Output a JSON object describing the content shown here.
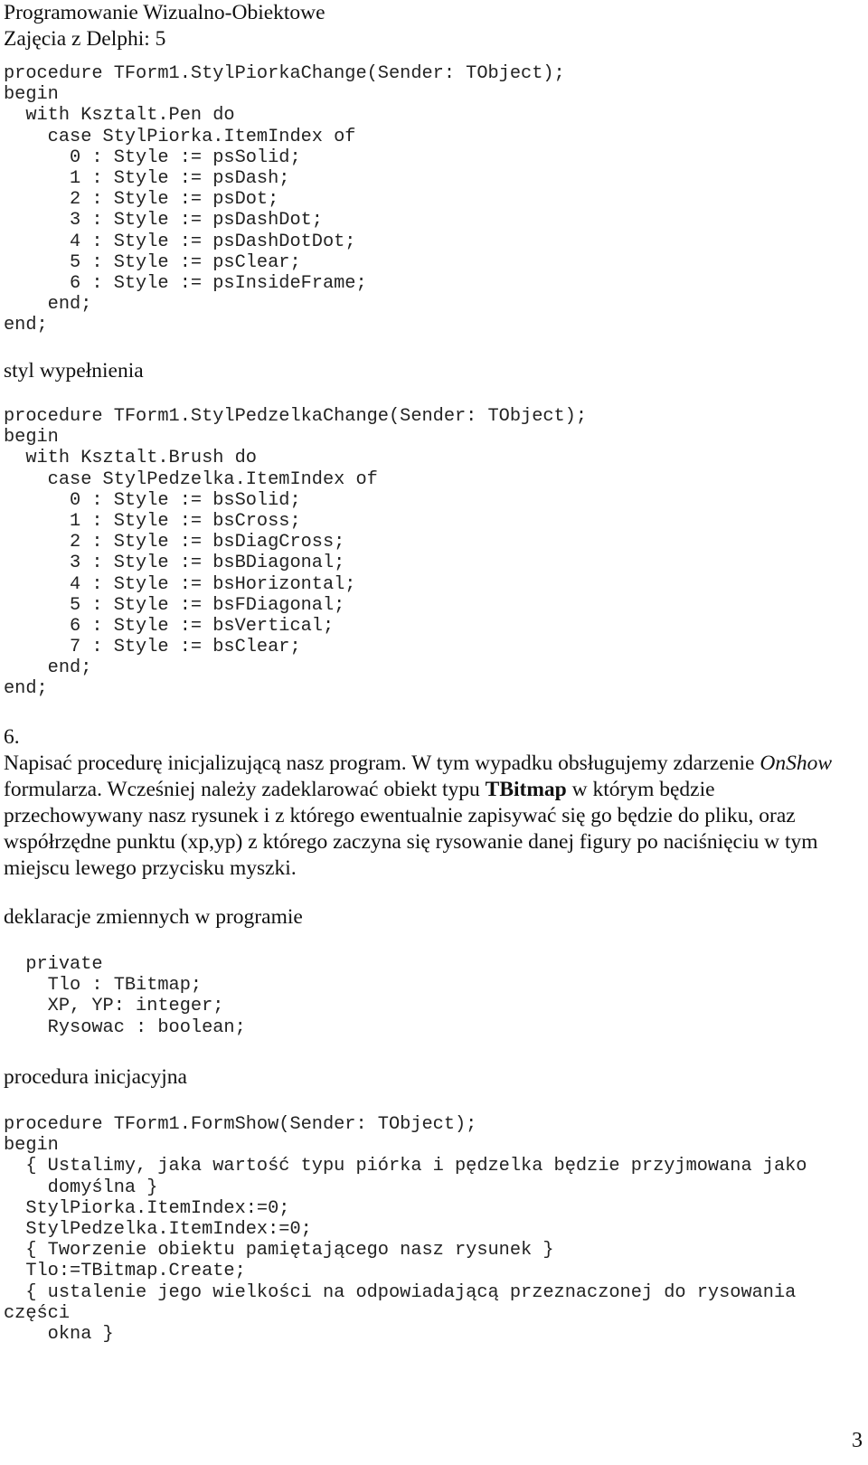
{
  "header": {
    "title": "Programowanie Wizualno-Obiektowe",
    "subtitle": "Zajęcia z Delphi: 5"
  },
  "code_pen": [
    "procedure TForm1.StylPiorkaChange(Sender: TObject);",
    "begin",
    "  with Ksztalt.Pen do",
    "    case StylPiorka.ItemIndex of",
    "      0 : Style := psSolid;",
    "      1 : Style := psDash;",
    "      2 : Style := psDot;",
    "      3 : Style := psDashDot;",
    "      4 : Style := psDashDotDot;",
    "      5 : Style := psClear;",
    "      6 : Style := psInsideFrame;",
    "    end;",
    "end;"
  ],
  "heading_fill": "styl wypełnienia",
  "code_brush": [
    "procedure TForm1.StylPedzelkaChange(Sender: TObject);",
    "begin",
    "  with Ksztalt.Brush do",
    "    case StylPedzelka.ItemIndex of",
    "      0 : Style := bsSolid;",
    "      1 : Style := bsCross;",
    "      2 : Style := bsDiagCross;",
    "      3 : Style := bsBDiagonal;",
    "      4 : Style := bsHorizontal;",
    "      5 : Style := bsFDiagonal;",
    "      6 : Style := bsVertical;",
    "      7 : Style := bsClear;",
    "    end;",
    "end;"
  ],
  "section6": {
    "number": "6.",
    "text_1": "Napisać procedurę inicjalizującą nasz program. W tym wypadku obsługujemy zdarzenie ",
    "event_name": "OnShow",
    "text_2": " formularza. Wcześniej należy zadeklarować obiekt typu ",
    "type_name": "TBitmap",
    "text_3": " w którym będzie przechowywany nasz rysunek i z którego ewentualnie zapisywać się go będzie do pliku, oraz współrzędne punktu (xp,yp) z którego zaczyna się rysowanie danej figury po naciśnięciu w tym miejscu lewego przycisku myszki."
  },
  "heading_decl": "deklaracje zmiennych w programie",
  "code_decl": [
    "  private",
    "    Tlo : TBitmap;",
    "    XP, YP: integer;",
    "    Rysowac : boolean;"
  ],
  "heading_init": "procedura inicjacyjna",
  "code_init": [
    "procedure TForm1.FormShow(Sender: TObject);",
    "begin",
    "  { Ustalimy, jaka wartość typu piórka i pędzelka będzie przyjmowana jako",
    "    domyślna }",
    "  StylPiorka.ItemIndex:=0;",
    "  StylPedzelka.ItemIndex:=0;",
    "  { Tworzenie obiektu pamiętającego nasz rysunek }",
    "  Tlo:=TBitmap.Create;",
    "  { ustalenie jego wielkości na odpowiadającą przeznaczonej do rysowania",
    "części",
    "    okna }"
  ],
  "page_number": "3"
}
